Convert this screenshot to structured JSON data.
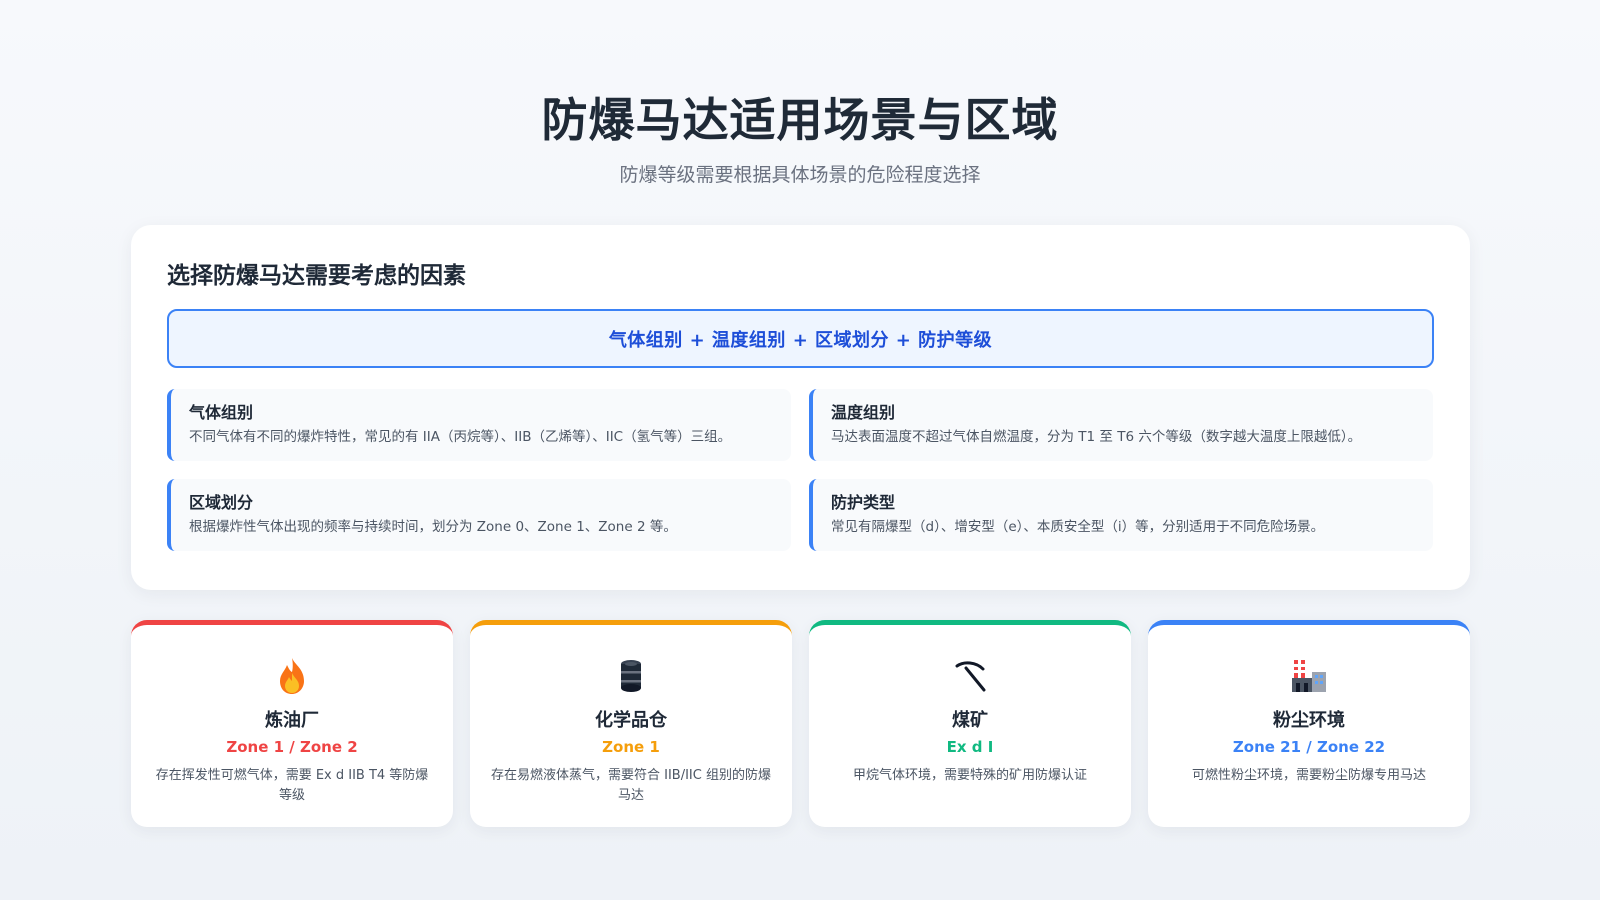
{
  "header": {
    "title": "防爆马达适用场景与区域",
    "subtitle": "防爆等级需要根据具体场景的危险程度选择"
  },
  "factors": {
    "title": "选择防爆马达需要考虑的因素",
    "formula": "气体组别 + 温度组别 + 区域划分 + 防护等级",
    "items": [
      {
        "name": "气体组别",
        "desc": "不同气体有不同的爆炸特性，常见的有 IIA（丙烷等）、IIB（乙烯等）、IIC（氢气等）三组。"
      },
      {
        "name": "温度组别",
        "desc": "马达表面温度不超过气体自燃温度，分为 T1 至 T6 六个等级（数字越大温度上限越低）。"
      },
      {
        "name": "区域划分",
        "desc": "根据爆炸性气体出现的频率与持续时间，划分为 Zone 0、Zone 1、Zone 2 等。"
      },
      {
        "name": "防护类型",
        "desc": "常见有隔爆型（d）、增安型（e）、本质安全型（i）等，分别适用于不同危险场景。"
      }
    ]
  },
  "scenarios": [
    {
      "icon": "fire-icon",
      "name": "炼油厂",
      "zone": "Zone 1 / Zone 2",
      "desc": "存在挥发性可燃气体，需要 Ex d IIB T4 等防爆等级",
      "color": "#ef4444"
    },
    {
      "icon": "oil-drum-icon",
      "name": "化学品仓",
      "zone": "Zone 1",
      "desc": "存在易燃液体蒸气，需要符合 IIB/IIC 组别的防爆马达",
      "color": "#f59e0b"
    },
    {
      "icon": "pickaxe-icon",
      "name": "煤矿",
      "zone": "Ex d I",
      "desc": "甲烷气体环境，需要特殊的矿用防爆认证",
      "color": "#10b981"
    },
    {
      "icon": "factory-icon",
      "name": "粉尘环境",
      "zone": "Zone 21 / Zone 22",
      "desc": "可燃性粉尘环境，需要粉尘防爆专用马达",
      "color": "#3b82f6"
    }
  ]
}
